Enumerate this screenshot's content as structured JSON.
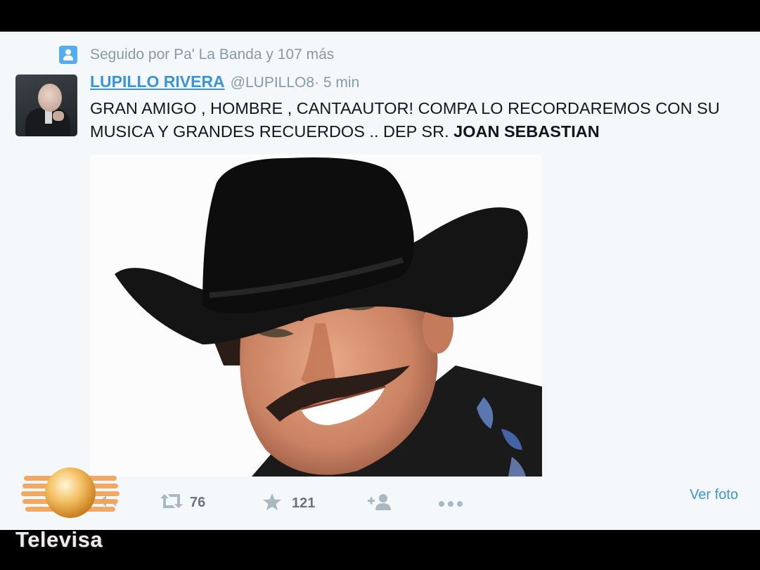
{
  "context": {
    "text": "Seguido por Pa' La Banda y 107 más",
    "icon": "follow-user-icon"
  },
  "tweet": {
    "author_name": "LUPILLO RIVERA",
    "handle": "@LUPILLO8",
    "time": " · 5 min",
    "text_plain": "GRAN AMIGO , HOMBRE , CANTAAUTOR! COMPA LO RECORDAREMOS CON SU MUSICA Y GRANDES RECUERDOS .. DEP SR. ",
    "text_bold": "JOAN SEBASTIAN"
  },
  "actions": {
    "reply_icon": "reply-icon",
    "retweet_icon": "retweet-icon",
    "retweet_count": "76",
    "favorite_icon": "star-icon",
    "favorite_count": "121",
    "follow_icon": "follow-add-icon",
    "more_icon": "more-dots-icon",
    "view_photo": "Ver foto"
  },
  "watermark": {
    "text": "Televisa"
  },
  "colors": {
    "link": "#3b94d9",
    "muted": "#8899a6",
    "background": "#f5f8fa"
  }
}
